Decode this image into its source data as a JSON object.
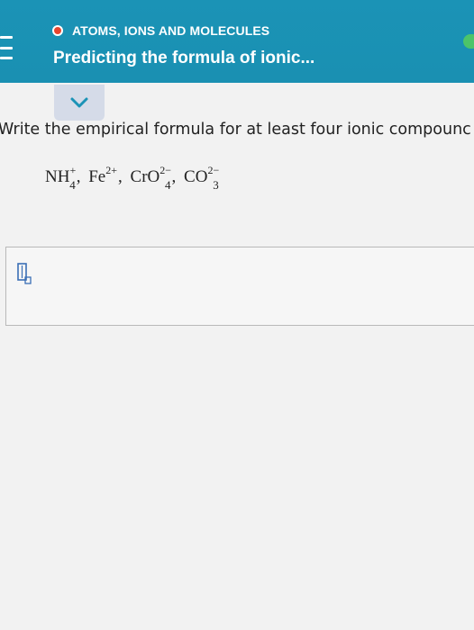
{
  "header": {
    "topic": "ATOMS, IONS AND MOLECULES",
    "title": "Predicting the formula of ionic...",
    "menu_icon": "hamburger-menu-icon",
    "colors": {
      "background": "#1b93b6",
      "topic_dot": "#e8452e",
      "pill": "#4cc46a"
    }
  },
  "collapse": {
    "icon": "chevron-down-icon",
    "color": "#1b93b6"
  },
  "question": {
    "prompt": "Write the empirical formula for at least four ionic compounc",
    "ions": [
      {
        "base": "NH",
        "sup": "+",
        "sub": "4"
      },
      {
        "base": "Fe",
        "sup": "2+",
        "sub": ""
      },
      {
        "base": "CrO",
        "sup": "2−",
        "sub": "4"
      },
      {
        "base": "CO",
        "sup": "2−",
        "sub": "3"
      }
    ]
  },
  "answer": {
    "value": "",
    "icon": "formula-subscript-icon"
  }
}
